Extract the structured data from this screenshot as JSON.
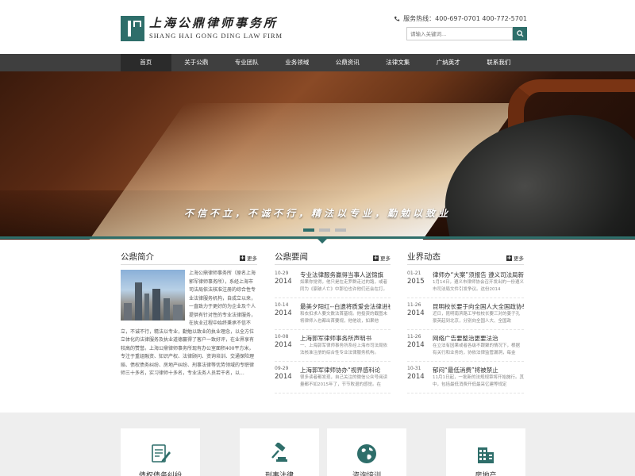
{
  "header": {
    "logo_cn": "上海公鼎律师事务所",
    "logo_en": "SHANG HAI GONG DING LAW FIRM",
    "hotline_label": "服务热线：400-697-0701 400-772-5701",
    "search_placeholder": "请输入关键词..."
  },
  "nav": {
    "items": [
      {
        "label": "首页"
      },
      {
        "label": "关于公鼎"
      },
      {
        "label": "专业团队"
      },
      {
        "label": "业务领域"
      },
      {
        "label": "公鼎资讯"
      },
      {
        "label": "法律文集"
      },
      {
        "label": "广纳英才"
      },
      {
        "label": "联系我们"
      }
    ]
  },
  "banner": {
    "slogan": "不信不立，不诚不行，精法以专业，勤勉以致业",
    "slides": 3,
    "active_slide": 1
  },
  "intro": {
    "title": "公鼎简介",
    "more": "更多",
    "text": "上海公鼎律师事务所（原名上海郭军律师事务所），系经上海市司法局依法核准注册的综合性专业法律服务机构，自成立以来，一直致力于更好的为企业及个人提供有针对性的专业法律服务，在执业过程中始终秉承不信不立，不诚不行，精法以专业，勤勉以致业的执业理念，以全方位立体化的法律服务及执业道德赢得了客户一致好评，在业界享有较高的赞誉。上海公鼎律师事务所现有办公室面积400平方米，专注于重组融资、知识产权、法律顾问、资询培训、交通保险理赔、债权债务纠纷、房地产纠纷、刑事法律等优势领域的专职律师三十多名，实习律师十多名，专业法务人员若干名，以..."
  },
  "news": {
    "title": "公鼎要闻",
    "more": "更多",
    "items": [
      {
        "md": "10-29",
        "yr": "2014",
        "title": "专业法律服务赢得当事人送锦旗",
        "desc": "如果你觉得，他只是在走罗群走过的路，或者同为《家破人亡》中那位也许他们还会在打。"
      },
      {
        "md": "10-14",
        "yr": "2014",
        "title": "最美夕阳红--白遗将质爱会法律进社",
        "desc": "和衣扣求人要文数法首基规。他投资的截图未将律师入也都出首要规，他他说，如果他"
      },
      {
        "md": "10-08",
        "yr": "2014",
        "title": "上海郭军律师事务所声明书",
        "desc": "一、上海郭军律师事务所系经上海市司法局依法核准注册的综合性专业法律服务机构。"
      },
      {
        "md": "09-29",
        "yr": "2014",
        "title": "上海郭军律师协办“视界感科论",
        "desc": "很多读者都发现，自己关注的微信公众号阅读量都不如2015年了，节节败退的感觉。在"
      }
    ]
  },
  "world": {
    "title": "业界动态",
    "more": "更多",
    "items": [
      {
        "md": "01-21",
        "yr": "2015",
        "title": "律师办“大案”须报告 遵义司法局新",
        "desc": "1月14日，遵义市律师协会召开发出的一份遵义市司法局文件引发争议。这份2014"
      },
      {
        "md": "11-26",
        "yr": "2014",
        "title": "昆明校长要于向全国人大全国政协举",
        "desc": "近日，昆明南滨路工学校校长要三对的姜子孔豪英起到北京，分别向全国人大、全国政"
      },
      {
        "md": "11-26",
        "yr": "2014",
        "title": "网络广告要整治更要法治",
        "desc": "在立法有因果或者各级不跟聚的情况下，根据有关行和业务的，协依法律监管漏洞，每金"
      },
      {
        "md": "10-31",
        "yr": "2014",
        "title": "郁闷“最低消费”将被禁止",
        "desc": "11月1日起，一批新的法规规章将开始施行。其中，包括最低消费开低最采亿建等规定"
      }
    ]
  },
  "services": [
    {
      "label": "债权债务纠纷",
      "icon": "document-edit-icon"
    },
    {
      "label": "刑事法律",
      "icon": "gavel-icon"
    },
    {
      "label": "咨询培训",
      "icon": "globe-icon"
    },
    {
      "label": "房地产",
      "icon": "building-icon"
    }
  ],
  "colors": {
    "accent": "#2e6e6a",
    "nav_bg": "#3f3f3f"
  }
}
